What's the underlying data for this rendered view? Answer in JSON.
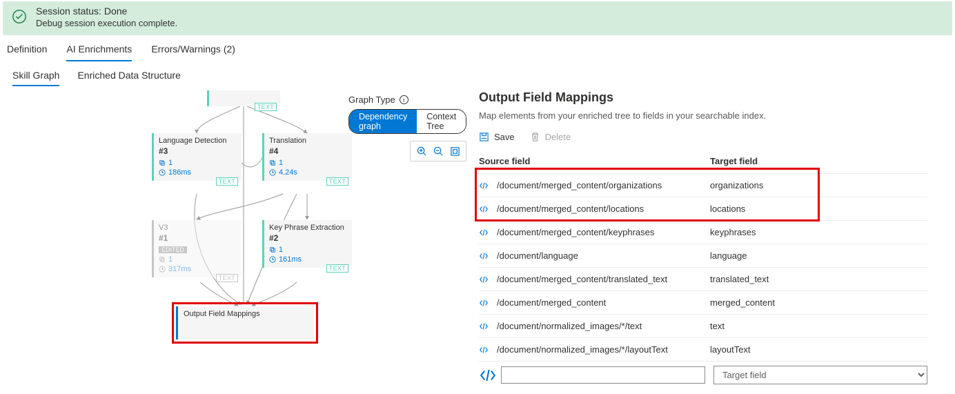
{
  "status": {
    "title": "Session status: Done",
    "subtitle": "Debug session execution complete."
  },
  "tabs": {
    "definition": "Definition",
    "enrichments": "AI Enrichments",
    "errors_label": "Errors/Warnings (2)"
  },
  "subtabs": {
    "skill_graph": "Skill Graph",
    "enriched": "Enriched Data Structure"
  },
  "graph_type": {
    "label": "Graph Type",
    "dependency": "Dependency graph",
    "context": "Context Tree"
  },
  "badges": {
    "text": "TEXT",
    "edited": "EDITED"
  },
  "skills": {
    "lang_detect": {
      "title": "Language Detection",
      "id": "#3",
      "count": "1",
      "time": "186ms"
    },
    "translation": {
      "title": "Translation",
      "id": "#4",
      "count": "1",
      "time": "4.24s"
    },
    "v3": {
      "title": "V3",
      "id": "#1",
      "count": "1",
      "time": "317ms"
    },
    "keyphrase": {
      "title": "Key Phrase Extraction",
      "id": "#2",
      "count": "1",
      "time": "161ms"
    }
  },
  "output_box": {
    "title": "Output Field Mappings"
  },
  "right": {
    "heading": "Output Field Mappings",
    "desc": "Map elements from your enriched tree to fields in your searchable index.",
    "save": "Save",
    "delete": "Delete",
    "col_source": "Source field",
    "col_target": "Target field",
    "target_placeholder": "Target field",
    "mappings": [
      {
        "src": "/document/merged_content/organizations",
        "tgt": "organizations"
      },
      {
        "src": "/document/merged_content/locations",
        "tgt": "locations"
      },
      {
        "src": "/document/merged_content/keyphrases",
        "tgt": "keyphrases"
      },
      {
        "src": "/document/language",
        "tgt": "language"
      },
      {
        "src": "/document/merged_content/translated_text",
        "tgt": "translated_text"
      },
      {
        "src": "/document/merged_content",
        "tgt": "merged_content"
      },
      {
        "src": "/document/normalized_images/*/text",
        "tgt": "text"
      },
      {
        "src": "/document/normalized_images/*/layoutText",
        "tgt": "layoutText"
      }
    ]
  }
}
